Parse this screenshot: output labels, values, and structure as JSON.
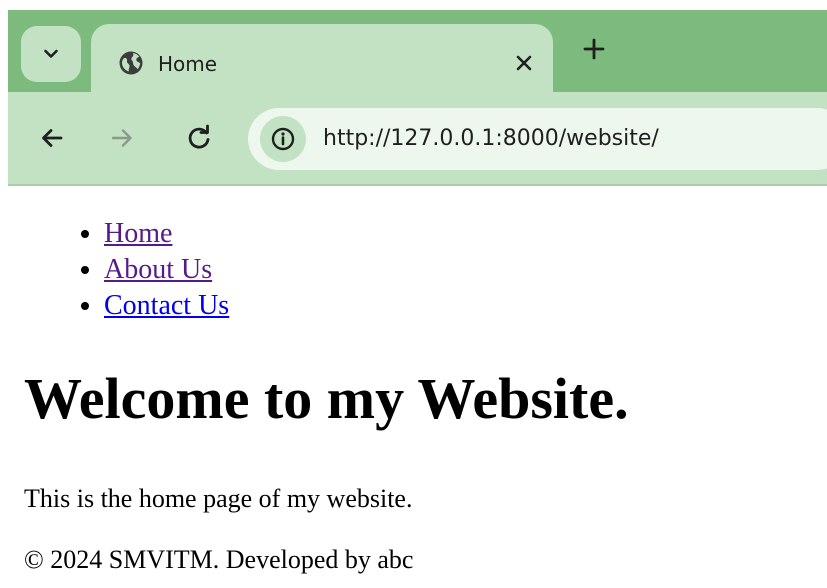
{
  "browser": {
    "tab": {
      "title": "Home",
      "favicon": "globe-icon"
    },
    "controls": {
      "tab_search_icon": "chevron-down-icon",
      "close_icon": "close-icon",
      "new_tab_icon": "plus-icon",
      "back_icon": "arrow-left-icon",
      "forward_icon": "arrow-right-icon",
      "reload_icon": "reload-icon",
      "site_info_icon": "info-icon"
    },
    "address_bar": {
      "url": "http://127.0.0.1:8000/website/"
    },
    "colors": {
      "frame": "#7dba7d",
      "toolbar": "#c3e2c3",
      "omnibox": "#eef7ee"
    }
  },
  "page": {
    "nav": [
      {
        "label": "Home",
        "visited": true
      },
      {
        "label": "About Us",
        "visited": true
      },
      {
        "label": "Contact Us",
        "visited": false
      }
    ],
    "heading": "Welcome to my Website.",
    "intro": "This is the home page of my website.",
    "footer": "© 2024 SMVITM. Developed by abc",
    "colors": {
      "visited_link": "#551a8b",
      "unvisited_link": "#0000ee"
    }
  }
}
